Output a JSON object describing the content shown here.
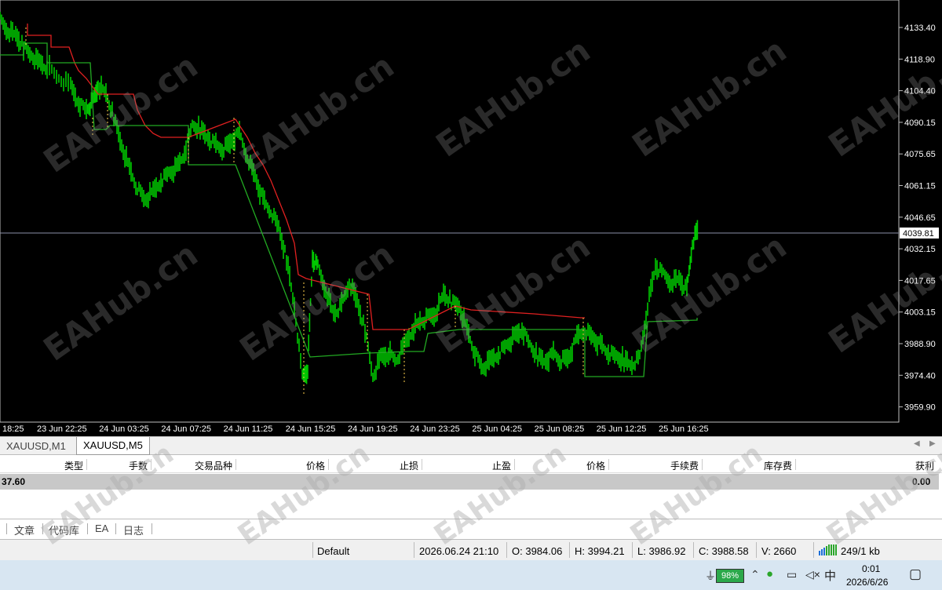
{
  "chart": {
    "price_labels": [
      "4133.40",
      "4118.90",
      "4104.40",
      "4090.15",
      "4075.65",
      "4061.15",
      "4046.65",
      "4032.15",
      "4017.65",
      "4003.15",
      "3988.90",
      "3974.40",
      "3959.90"
    ],
    "current_price": "4039.81",
    "time_labels": [
      "18:25",
      "23 Jun 22:25",
      "24 Jun 03:25",
      "24 Jun 07:25",
      "24 Jun 11:25",
      "24 Jun 15:25",
      "24 Jun 19:25",
      "24 Jun 23:25",
      "25 Jun 04:25",
      "25 Jun 08:25",
      "25 Jun 12:25",
      "25 Jun 16:25"
    ],
    "watermark": "EAHub.cn",
    "colors": {
      "candle": "#00c800",
      "upper_band": "#e02020",
      "lower_band": "#22aa22",
      "background": "#000000"
    }
  },
  "tabs": {
    "items": [
      "XAUUSD,M1",
      "XAUUSD,M5"
    ],
    "active": "XAUUSD,M5"
  },
  "table": {
    "headers": [
      "类型",
      "手数",
      "交易品种",
      "价格",
      "止损",
      "止盈",
      "价格",
      "手续费",
      "库存费",
      "获利"
    ],
    "row": {
      "balance": "37.60",
      "profit": "0.00"
    }
  },
  "bottom_tabs": [
    "文章",
    "代码库",
    "EA",
    "日志"
  ],
  "status": {
    "profile": "Default",
    "datetime": "2026.06.24 21:10",
    "open": "O: 3984.06",
    "high": "H: 3994.21",
    "low": "L: 3986.92",
    "close": "C: 3988.58",
    "volume": "V: 2660",
    "traffic": "249/1 kb"
  },
  "taskbar": {
    "battery": "98%",
    "time": "0:01",
    "date": "2026/6/26"
  }
}
